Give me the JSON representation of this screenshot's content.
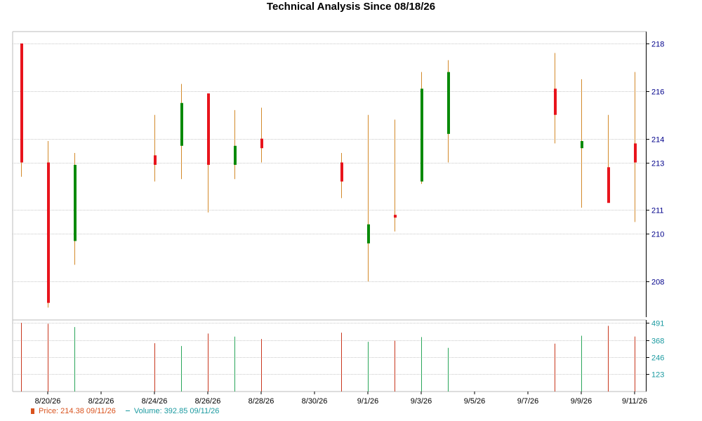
{
  "chart_data": {
    "type": "candlestick",
    "title": "Technical Analysis Since 08/18/26",
    "price_axis": {
      "ylim": [
        206.5,
        218.5
      ],
      "ticks": [
        208,
        210,
        211,
        213,
        214,
        216,
        218
      ]
    },
    "volume_axis": {
      "ylim": [
        0,
        491
      ],
      "ticks": [
        123,
        246,
        368,
        491
      ]
    },
    "x_tick_labels": [
      "8/20/26",
      "8/22/26",
      "8/24/26",
      "8/26/26",
      "8/28/26",
      "8/30/26",
      "9/1/26",
      "9/3/26",
      "9/5/26",
      "9/7/26",
      "9/9/26",
      "9/11/26"
    ],
    "candles": [
      {
        "date": "8/19/26",
        "open": 218.0,
        "high": 218.0,
        "low": 212.4,
        "close": 213.0,
        "direction": "down",
        "volume": 491
      },
      {
        "date": "8/20/26",
        "open": 213.0,
        "high": 213.9,
        "low": 206.9,
        "close": 207.1,
        "direction": "down",
        "volume": 484
      },
      {
        "date": "8/21/26",
        "open": 209.7,
        "high": 213.4,
        "low": 208.7,
        "close": 212.9,
        "direction": "up",
        "volume": 460
      },
      {
        "date": "8/24/26",
        "open": 213.3,
        "high": 215.0,
        "low": 212.2,
        "close": 212.9,
        "direction": "down",
        "volume": 345
      },
      {
        "date": "8/25/26",
        "open": 213.7,
        "high": 216.3,
        "low": 212.3,
        "close": 215.5,
        "direction": "up",
        "volume": 325
      },
      {
        "date": "8/26/26",
        "open": 215.9,
        "high": 215.9,
        "low": 210.9,
        "close": 212.9,
        "direction": "down",
        "volume": 414
      },
      {
        "date": "8/27/26",
        "open": 212.9,
        "high": 215.2,
        "low": 212.3,
        "close": 213.7,
        "direction": "up",
        "volume": 392
      },
      {
        "date": "8/28/26",
        "open": 214.0,
        "high": 215.3,
        "low": 213.0,
        "close": 213.6,
        "direction": "down",
        "volume": 375
      },
      {
        "date": "8/31/26",
        "open": 213.0,
        "high": 213.4,
        "low": 211.5,
        "close": 212.2,
        "direction": "down",
        "volume": 420
      },
      {
        "date": "9/1/26",
        "open": 209.6,
        "high": 215.0,
        "low": 208.0,
        "close": 210.4,
        "direction": "up",
        "volume": 355
      },
      {
        "date": "9/2/26",
        "open": 210.8,
        "high": 214.8,
        "low": 210.1,
        "close": 210.7,
        "direction": "down",
        "volume": 363
      },
      {
        "date": "9/3/26",
        "open": 212.2,
        "high": 216.8,
        "low": 212.1,
        "close": 216.1,
        "direction": "up",
        "volume": 389
      },
      {
        "date": "9/4/26",
        "open": 214.2,
        "high": 217.3,
        "low": 213.0,
        "close": 216.8,
        "direction": "up",
        "volume": 312
      },
      {
        "date": "9/8/26",
        "open": 216.1,
        "high": 217.6,
        "low": 213.8,
        "close": 215.0,
        "direction": "down",
        "volume": 342
      },
      {
        "date": "9/9/26",
        "open": 213.6,
        "high": 216.5,
        "low": 211.1,
        "close": 213.9,
        "direction": "up",
        "volume": 398
      },
      {
        "date": "9/10/26",
        "open": 212.8,
        "high": 215.0,
        "low": 211.4,
        "close": 211.3,
        "direction": "down",
        "volume": 469
      },
      {
        "date": "9/11/26",
        "open": 213.8,
        "high": 216.8,
        "low": 210.5,
        "close": 213.0,
        "direction": "down",
        "volume": 392.85
      }
    ],
    "grid": true,
    "legend_position": "bottom-left",
    "colors": {
      "up": "#0a8a0a",
      "down": "#e8141c",
      "wick": "#d38a2b",
      "vol_up": "#2aa65a",
      "vol_down": "#c8371e",
      "axis_label": "#00008b",
      "vol_axis_label": "#1b9aa0",
      "grid": "#c8c8c8"
    }
  },
  "legend": {
    "price_label": "Price: 214.38  09/11/26",
    "volume_label": "Volume: 392.85  09/11/26"
  }
}
